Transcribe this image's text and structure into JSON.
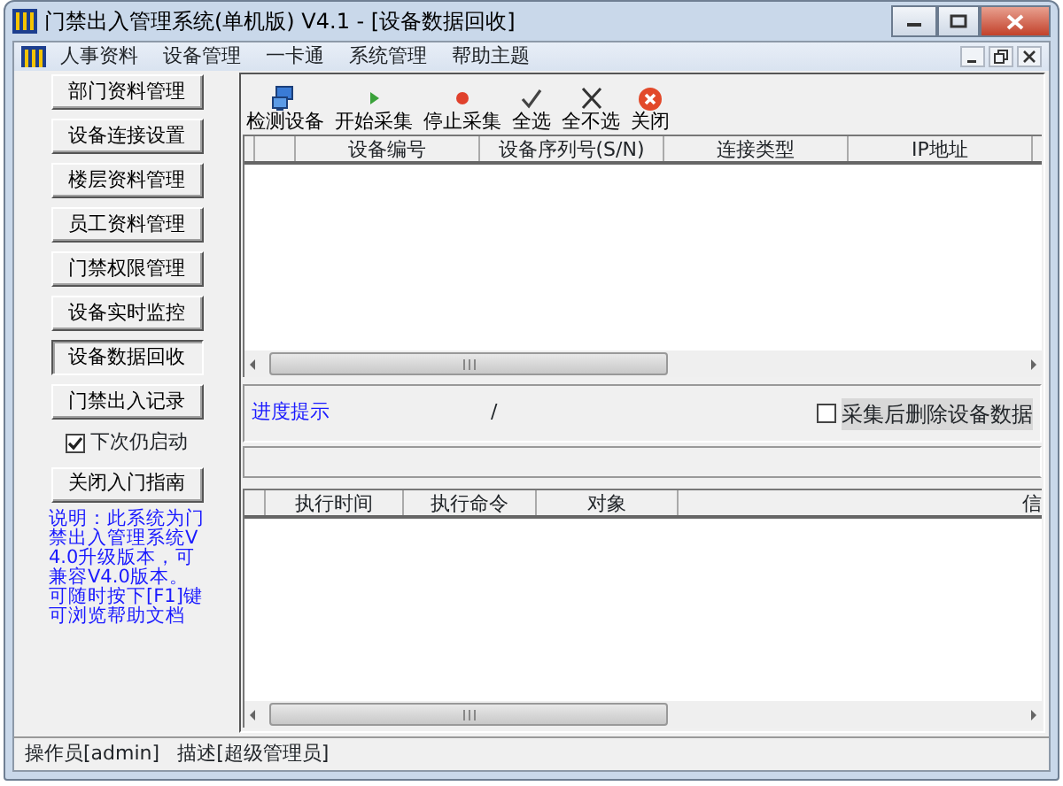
{
  "window": {
    "title": "门禁出入管理系统(单机版)  V4.1 - [设备数据回收]"
  },
  "menu": [
    "人事资料",
    "设备管理",
    "一卡通",
    "系统管理",
    "帮助主题"
  ],
  "sidebar": {
    "buttons": [
      {
        "label": "部门资料管理",
        "selected": false
      },
      {
        "label": "设备连接设置",
        "selected": false
      },
      {
        "label": "楼层资料管理",
        "selected": false
      },
      {
        "label": "员工资料管理",
        "selected": false
      },
      {
        "label": "门禁权限管理",
        "selected": false
      },
      {
        "label": "设备实时监控",
        "selected": false
      },
      {
        "label": "设备数据回收",
        "selected": true
      },
      {
        "label": "门禁出入记录",
        "selected": false
      }
    ],
    "startup_checkbox": {
      "label": "下次仍启动",
      "checked": true
    },
    "guide_button": "关闭入门指南",
    "note": "说明：此系统为门禁出入管理系统V4.0升级版本，可兼容V4.0版本。可随时按下[F1]键可浏览帮助文档"
  },
  "toolbar": [
    {
      "label": "检测设备",
      "kind": "monitor"
    },
    {
      "label": "开始采集",
      "kind": "play"
    },
    {
      "label": "停止采集",
      "kind": "record"
    },
    {
      "label": "全选",
      "kind": "check"
    },
    {
      "label": "全不选",
      "kind": "cross"
    },
    {
      "label": "关闭",
      "kind": "close"
    }
  ],
  "device_table": {
    "columns": [
      "设备编号",
      "设备序列号(S/N)",
      "连接类型",
      "IP地址"
    ]
  },
  "progress": {
    "label": "进度提示",
    "value": "/",
    "delete_checkbox": {
      "label": "采集后删除设备数据",
      "checked": false
    }
  },
  "log_table": {
    "columns": [
      "执行时间",
      "执行命令",
      "对象",
      "信"
    ]
  },
  "status_bar": [
    "操作员[admin]",
    "描述[超级管理员]"
  ]
}
